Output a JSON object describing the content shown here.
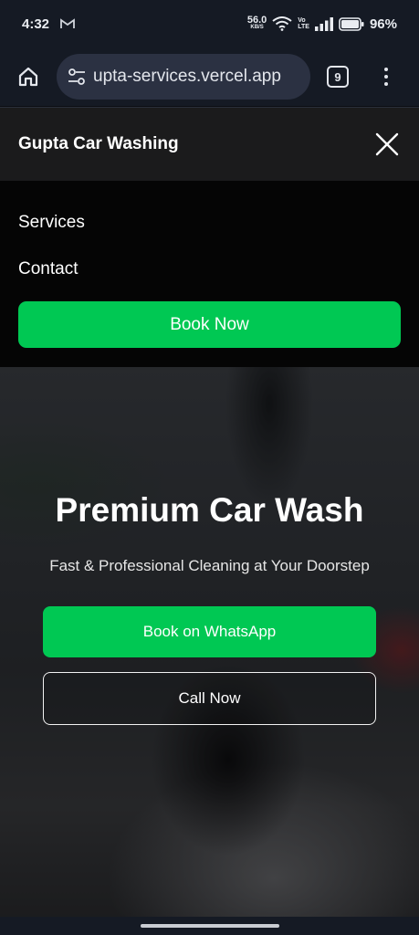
{
  "status_bar": {
    "time": "4:32",
    "net_speed_value": "56.0",
    "net_speed_unit": "KB/S",
    "volte_top": "Vo",
    "volte_bottom": "LTE",
    "battery": "96%",
    "icons": [
      "gmail-icon",
      "wifi-icon",
      "signal-icon",
      "battery-icon"
    ]
  },
  "browser": {
    "url": "upta-services.vercel.app",
    "tab_count": "9",
    "icons": [
      "home-icon",
      "tune-icon",
      "tabs-icon",
      "more-vert-icon"
    ]
  },
  "site_header": {
    "brand": "Gupta Car Washing",
    "close_icon": "close-icon"
  },
  "mobile_menu": {
    "items": [
      {
        "label": "Services"
      },
      {
        "label": "Contact"
      }
    ],
    "book_label": "Book Now"
  },
  "hero": {
    "title": "Premium Car Wash",
    "subtitle": "Fast & Professional Cleaning at Your Doorstep",
    "whatsapp_label": "Book on WhatsApp",
    "call_label": "Call Now"
  },
  "colors": {
    "accent_green": "#00c853",
    "header_bg": "#1b1b1c",
    "menu_bg": "#050505",
    "browser_bg": "#151a24"
  }
}
